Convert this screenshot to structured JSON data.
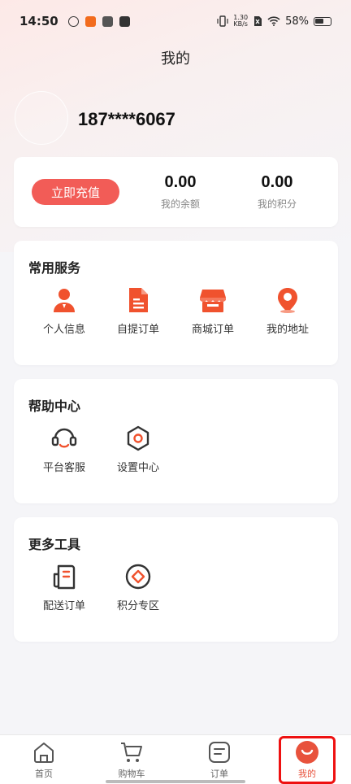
{
  "status_bar": {
    "time": "14:50",
    "net_speed_value": "1.30",
    "net_speed_unit": "KB/s",
    "battery": "58%"
  },
  "page": {
    "title": "我的"
  },
  "user": {
    "phone": "187****6067"
  },
  "balance": {
    "recharge_label": "立即充值",
    "balance_value": "0.00",
    "balance_label": "我的余额",
    "points_value": "0.00",
    "points_label": "我的积分"
  },
  "services": {
    "title": "常用服务",
    "items": [
      {
        "label": "个人信息",
        "icon": "person-icon"
      },
      {
        "label": "自提订单",
        "icon": "document-icon"
      },
      {
        "label": "商城订单",
        "icon": "store-icon"
      },
      {
        "label": "我的地址",
        "icon": "location-pin-icon"
      }
    ]
  },
  "help": {
    "title": "帮助中心",
    "items": [
      {
        "label": "平台客服",
        "icon": "headset-icon"
      },
      {
        "label": "设置中心",
        "icon": "hexagon-settings-icon"
      }
    ]
  },
  "tools": {
    "title": "更多工具",
    "items": [
      {
        "label": "配送订单",
        "icon": "delivery-document-icon"
      },
      {
        "label": "积分专区",
        "icon": "points-badge-icon"
      }
    ]
  },
  "bottom_nav": {
    "items": [
      {
        "label": "首页",
        "icon": "home-icon"
      },
      {
        "label": "购物车",
        "icon": "cart-icon"
      },
      {
        "label": "订单",
        "icon": "order-icon"
      },
      {
        "label": "我的",
        "icon": "smile-profile-icon",
        "active": true
      }
    ]
  },
  "colors": {
    "accent": "#f25c57",
    "icon_orange": "#f0522e",
    "nav_active": "#e8523c",
    "highlight": "#ee1111"
  }
}
